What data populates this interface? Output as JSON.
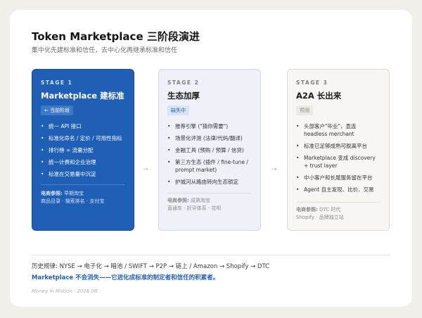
{
  "title": "Token Marketplace 三阶段演进",
  "subtitle": "集中化先建标准和信任，去中心化再继承标准和信任",
  "stages": [
    {
      "label": "STAGE 1",
      "name": "Marketplace 建标准",
      "badge": "← 当前阶段",
      "points": [
        "统一 API 接口",
        "标准化命名 / 定价 / 可用性指标",
        "排行榜 = 流量分配",
        "统一计费和企业治理",
        "标准在交易量中沉淀"
      ],
      "ref_label": "电商参照:",
      "ref_line1": "早期淘宝",
      "ref_line2": "商品目录 · 搜索排名 · 支付宝"
    },
    {
      "label": "STAGE 2",
      "name": "生态加厚",
      "badge": "缺失中",
      "points": [
        "推荐引擎 (\"猜你需要\")",
        "场景化评测 (法律/代码/翻译)",
        "金融工具 (预购 / 预算 / 信贷)",
        "第三方生态 (插件 / fine-tune / prompt market)",
        "护城河从路由转向生态锁定"
      ],
      "ref_label": "电商参照:",
      "ref_line1": "成熟淘宝",
      "ref_line2": "直通车 · 好评体系 · 花呗"
    },
    {
      "label": "STAGE 3",
      "name": "A2A 长出来",
      "badge": "预测",
      "points": [
        "头部客户\"毕业\"，直连 headless merchant",
        "标准已足够成熟可脱离平台",
        "Marketplace 变成 discovery + trust layer",
        "中小客户和长尾服务留在平台",
        "Agent 自主发现、比价、交易"
      ],
      "ref_label": "电商参照:",
      "ref_line1": "DTC 时代",
      "ref_line2": "Shopify · 品牌独立站"
    }
  ],
  "arrows": [
    "→",
    "→"
  ],
  "history": "历史规律: NYSE → 电子化 → 暗池 / SWIFT → P2P → 链上 / Amazon → Shopify → DTC",
  "conclusion": "Marketplace 不会消失——它进化成标准的制定者和信任的积累者。",
  "footer": "Money in Motion · 2026.06",
  "colors": {
    "stage1_bg": "#1f5fb6",
    "stage2_bg": "#eef2f8",
    "stage3_bg": "#f7f6f2",
    "accent": "#1f5fb6"
  }
}
